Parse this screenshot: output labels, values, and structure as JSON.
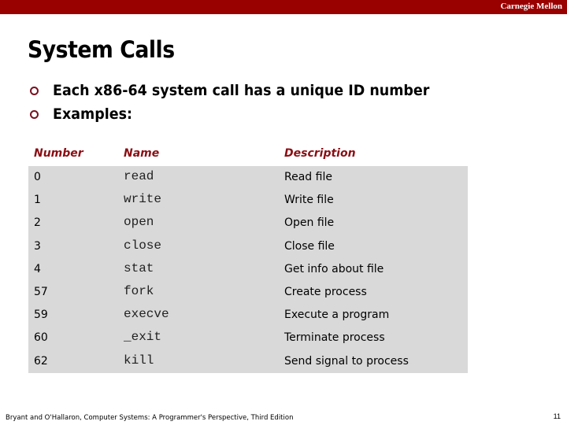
{
  "header": {
    "brand": "Carnegie Mellon",
    "bar_color": "#990000"
  },
  "slide": {
    "title": "System Calls",
    "bullets": [
      "Each x86-64 system call has a unique ID number",
      "Examples:"
    ]
  },
  "table": {
    "headers": {
      "number": "Number",
      "name": "Name",
      "description": "Description"
    },
    "rows": [
      {
        "number": "0",
        "name": "read",
        "description": "Read file"
      },
      {
        "number": "1",
        "name": "write",
        "description": "Write file"
      },
      {
        "number": "2",
        "name": "open",
        "description": "Open file"
      },
      {
        "number": "3",
        "name": "close",
        "description": "Close file"
      },
      {
        "number": "4",
        "name": "stat",
        "description": "Get info about file"
      },
      {
        "number": "57",
        "name": "fork",
        "description": "Create process"
      },
      {
        "number": "59",
        "name": "execve",
        "description": "Execute a program"
      },
      {
        "number": "60",
        "name": "_exit",
        "description": "Terminate process"
      },
      {
        "number": "62",
        "name": "kill",
        "description": "Send signal to process"
      }
    ]
  },
  "footer": {
    "citation": "Bryant and O'Hallaron, Computer Systems: A Programmer's Perspective, Third Edition",
    "page_number": "11"
  }
}
